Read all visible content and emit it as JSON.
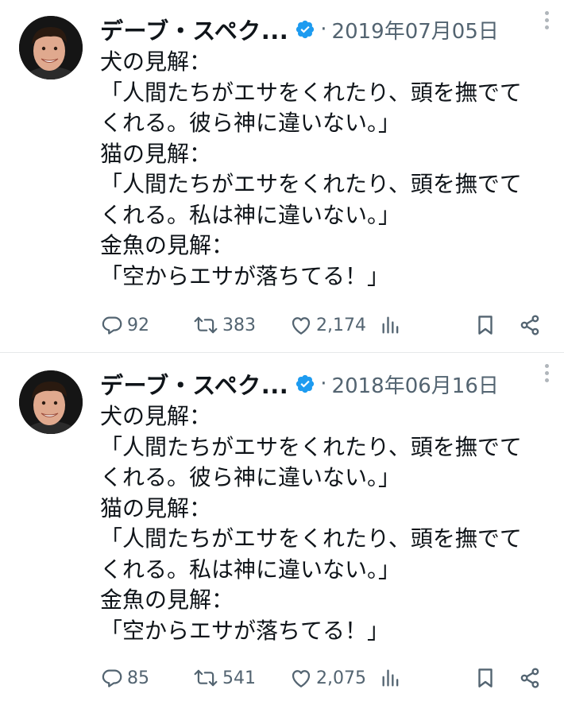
{
  "tweets": [
    {
      "author": "デーブ・スペク...",
      "separator": "·",
      "date": "2019年07月05日",
      "lines": [
        "犬の見解：",
        "「人間たちがエサをくれたり、頭を撫でて",
        "くれる。彼ら神に違いない。」",
        "猫の見解：",
        "「人間たちがエサをくれたり、頭を撫でて",
        "くれる。私は神に違いない。」",
        "金魚の見解：",
        "「空からエサが落ちてる！」"
      ],
      "replies": "92",
      "retweets": "383",
      "likes": "2,174"
    },
    {
      "author": "デーブ・スペク...",
      "separator": "·",
      "date": "2018年06月16日",
      "lines": [
        "犬の見解：",
        "「人間たちがエサをくれたり、頭を撫でて",
        "くれる。彼ら神に違いない。」",
        "猫の見解：",
        "「人間たちがエサをくれたり、頭を撫でて",
        "くれる。私は神に違いない。」",
        "金魚の見解：",
        "「空からエサが落ちてる！」"
      ],
      "replies": "85",
      "retweets": "541",
      "likes": "2,075"
    }
  ],
  "colors": {
    "text": "#0f1419",
    "secondary": "#536471",
    "verified": "#1d9bf0",
    "divider": "#e6e8ea"
  },
  "icons": [
    "verified-badge-icon",
    "more-icon",
    "reply-icon",
    "retweet-icon",
    "like-icon",
    "views-icon",
    "bookmark-icon",
    "share-icon"
  ]
}
